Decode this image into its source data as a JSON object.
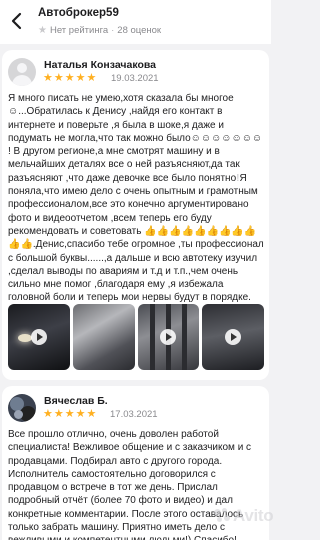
{
  "header": {
    "title": "Автоброкер59",
    "no_rating": "Нет рейтинга",
    "separator": "·",
    "reviews_count": "28 оценок"
  },
  "reviews": [
    {
      "author": "Наталья Конзачакова",
      "rating": 5,
      "date": "19.03.2021",
      "text_parts": [
        "Я много писать не умею,хотя сказала бы многое ☺...Обратилась к Денису ,найдя его контакт в интернете и поверьте ,я была в шоке,я даже и подумать не могла,что так можно было☺☺☺☺☺☺☺ ! В другом регионе,а мне смотрят машину и в мельчайших деталях все о ней разъясняют,да так разъясняют ,что даже девочке все было понятно",
        "Я поняла,что имею дело с очень опытным и грамотным профессионалом,все это конечно аргументировано фото и видеоотчетом ,всем теперь его буду рекомендовать и советовать 👍👍👍👍👍👍👍👍👍👍👍.Денис,спасибо тебе огромное ,ты профессионал с большой буквы......,а дальше и всю автотеку изучил ,сделал выводы по авариям и т.д и т.п.,чем очень сильно мне помог ,благодаря ему ,я избежала головной боли и теперь мои нервы будут в порядке."
      ],
      "emphasis": "!"
    },
    {
      "author": "Вячеслав Б.",
      "rating": 5,
      "date": "17.03.2021",
      "text": "Все прошло отлично, очень доволен работой специалиста! Вежливое общение и с заказчиком и с продавцами. Подбирал авто с другого города. Исполнитель самостоятельно договорился с продавцом о встрече в тот же день. Прислал подробный отчёт (более 70 фото и видео) и дал конкретные комментарии. После этого оставалось только забрать машину. Приятно иметь дело с вежливыми и компетентными людьми!) Спасибо!"
    }
  ],
  "watermark": "Avito"
}
